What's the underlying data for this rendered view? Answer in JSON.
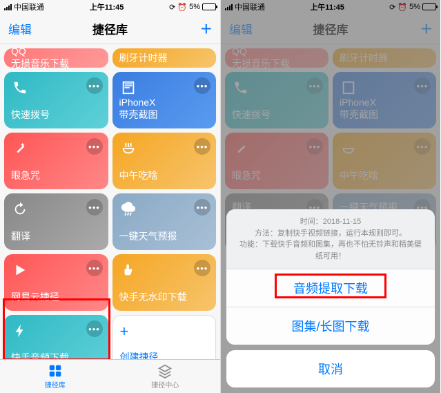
{
  "status": {
    "carrier": "中国联通",
    "time": "上午11:45",
    "battery": "5%"
  },
  "nav": {
    "edit": "编辑",
    "title": "捷径库"
  },
  "cards": {
    "qq": "QQ\n无损音乐下载",
    "brush": "刷牙计时器",
    "dial": "快速拨号",
    "iphonex": "iPhoneX\n带壳截图",
    "eye": "眼急咒",
    "lunch": "中午吃啥",
    "translate": "翻译",
    "weather": "一键天气预报",
    "netease": "网易云捷径",
    "kuaishou_nowm": "快手无水印下载",
    "kuaishou_audio": "快手音频下载",
    "create": "创建捷径"
  },
  "tabs": {
    "library": "捷径库",
    "gallery": "捷径中心"
  },
  "sheet": {
    "date": "时间：2018-11-15",
    "method": "方法：复制快手视频链接，运行本规则即可。",
    "feature": "功能：下载快手音频和图集，再也不怕无铃声和精美壁纸可用！",
    "opt1": "音频提取下载",
    "opt2": "图集/长图下载",
    "cancel": "取消"
  },
  "colors": {
    "pink": "linear-gradient(135deg,#f77,#f99)",
    "orange": "linear-gradient(135deg,#f5a623,#f7c46c)",
    "teal": "linear-gradient(135deg,#2fb9c4,#5fd0d8)",
    "blue": "linear-gradient(135deg,#3a7de0,#5a9bf0)",
    "red": "linear-gradient(135deg,#f55,#f88)",
    "gray": "linear-gradient(135deg,#888,#aaa)",
    "skygray": "linear-gradient(135deg,#8aa9c5,#a8c0d6)"
  }
}
